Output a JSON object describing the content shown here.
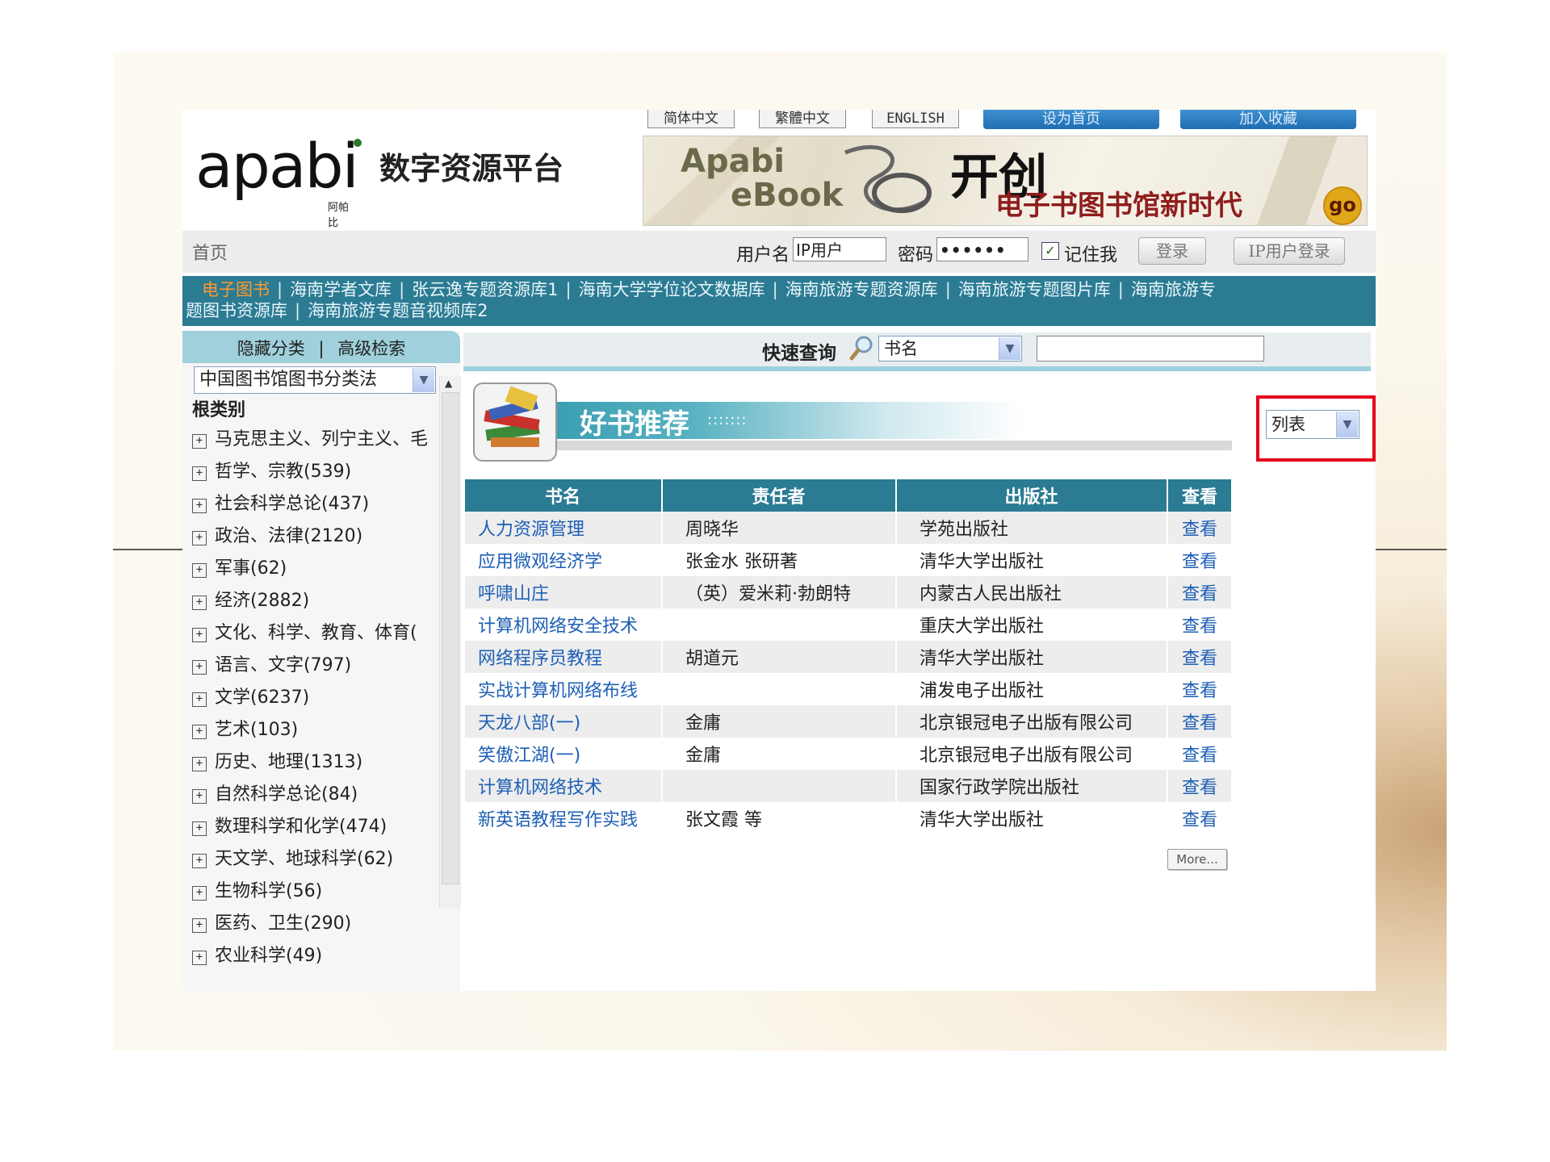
{
  "top_buttons": {
    "simplified": "简体中文",
    "traditional": "繁體中文",
    "english": "ENGLISH",
    "set_home": "设为首页",
    "bookmark": "加入收藏"
  },
  "logo": {
    "brand": "apabi",
    "brand_small": "阿帕比",
    "platform": "数字资源平台"
  },
  "banner": {
    "line1": "Apabi",
    "line2": "eBook",
    "headline": "开创",
    "slogan": "电子书图书馆新时代",
    "go_label": "go"
  },
  "login": {
    "home": "首页",
    "username_label": "用户名",
    "username_value": "IP用户",
    "password_label": "密码",
    "password_value": "••••••",
    "remember_label": "记住我",
    "remember_checked": true,
    "login_button": "登录",
    "ip_login_button": "IP用户登录"
  },
  "nav": {
    "items": [
      {
        "label": "电子图书",
        "active": true
      },
      {
        "label": "海南学者文库"
      },
      {
        "label": "张云逸专题资源库1"
      },
      {
        "label": "海南大学学位论文数据库"
      },
      {
        "label": "海南旅游专题资源库"
      },
      {
        "label": "海南旅游专题图片库"
      },
      {
        "label": "海南旅游专"
      },
      {
        "label": "题图书资源库"
      },
      {
        "label": "海南旅游专题音视频库2"
      }
    ]
  },
  "left_header": {
    "hide_category": "隐藏分类",
    "advanced_search": "高级检索",
    "separator": "|"
  },
  "search": {
    "quick_label": "快速查询",
    "field_value": "书名",
    "query_button": "查询",
    "input_value": ""
  },
  "classification": {
    "scheme": "中国图书馆图书分类法",
    "root": "根类别"
  },
  "categories": [
    "马克思主义、列宁主义、毛",
    "哲学、宗教(539)",
    "社会科学总论(437)",
    "政治、法律(2120)",
    "军事(62)",
    "经济(2882)",
    "文化、科学、教育、体育(",
    "语言、文字(797)",
    "文学(6237)",
    "艺术(103)",
    "历史、地理(1313)",
    "自然科学总论(84)",
    "数理科学和化学(474)",
    "天文学、地球科学(62)",
    "生物科学(56)",
    "医药、卫生(290)",
    "农业科学(49)"
  ],
  "recommend": {
    "title": "好书推荐",
    "dots": ":::::::"
  },
  "view_select": {
    "value": "列表"
  },
  "table": {
    "headers": [
      "书名",
      "责任者",
      "出版社",
      "查看"
    ],
    "rows": [
      [
        "人力资源管理",
        "周晓华",
        "学苑出版社",
        "查看"
      ],
      [
        "应用微观经济学",
        "张金水 张研著",
        "清华大学出版社",
        "查看"
      ],
      [
        "呼啸山庄",
        "（英）爱米莉·勃朗特",
        "内蒙古人民出版社",
        "查看"
      ],
      [
        "计算机网络安全技术",
        "",
        "重庆大学出版社",
        "查看"
      ],
      [
        "网络程序员教程",
        "胡道元",
        "清华大学出版社",
        "查看"
      ],
      [
        "实战计算机网络布线",
        "",
        "浦发电子出版社",
        "查看"
      ],
      [
        "天龙八部(一)",
        "金庸",
        "北京银冠电子出版有限公司",
        "查看"
      ],
      [
        "笑傲江湖(一)",
        "金庸",
        "北京银冠电子出版有限公司",
        "查看"
      ],
      [
        "计算机网络技术",
        "",
        "国家行政学院出版社",
        "查看"
      ],
      [
        "新英语教程写作实践",
        "张文霞 等",
        "清华大学出版社",
        "查看"
      ]
    ]
  },
  "more_button": "More..."
}
